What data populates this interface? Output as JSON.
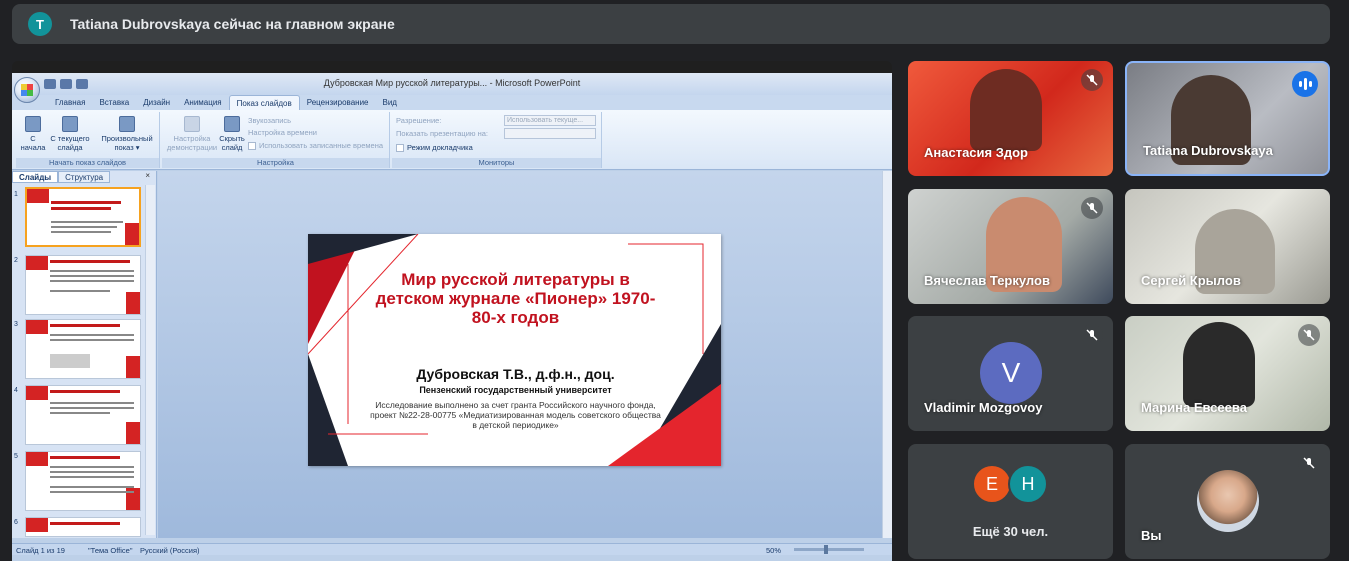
{
  "banner": {
    "avatar_letter": "T",
    "text": "Tatiana Dubrovskaya сейчас на главном экране"
  },
  "ppt": {
    "window_title": "Дубровская Мир русской литературы... - Microsoft PowerPoint",
    "tabs": [
      "Главная",
      "Вставка",
      "Дизайн",
      "Анимация",
      "Показ слайдов",
      "Рецензирование",
      "Вид"
    ],
    "active_tab": "Показ слайдов",
    "ribbon": {
      "btn_from_start": "С начала",
      "btn_from_current": "С текущего слайда",
      "btn_custom": "Произвольный показ ▾",
      "group_start": "Начать показ слайдов",
      "btn_setup": "Настройка демонстрации",
      "btn_hide": "Скрыть слайд",
      "chk_record": "Звукозапись",
      "chk_timings": "Настройка времени",
      "chk_use_timings": "Использовать записанные времена",
      "group_setup": "Настройка",
      "lbl_resolution": "Разрешение:",
      "val_resolution": "Использовать текуще...",
      "lbl_show_on": "Показать презентацию на:",
      "chk_presenter": "Режим докладчика",
      "group_monitors": "Мониторы"
    },
    "pane_tabs": [
      "Слайды",
      "Структура"
    ],
    "pane_close": "×",
    "thumb_numbers": [
      "1",
      "2",
      "3",
      "4",
      "5",
      "6"
    ],
    "slide": {
      "title": "Мир русской литературы в детском журнале «Пионер» 1970-80-х годов",
      "author": "Дубровская Т.В., д.ф.н., доц.",
      "university": "Пензенский государственный университет",
      "note": "Исследование выполнено за счет гранта Российского научного фонда, проект №22-28-00775 «Медиатизированная модель советского общества в детской периодике»"
    },
    "status": {
      "slide_count": "Слайд 1 из 19",
      "theme": "\"Тема Office\"",
      "language": "Русский (Россия)",
      "zoom": "50%"
    }
  },
  "participants": [
    {
      "name": "Анастасия Здор",
      "muted": true
    },
    {
      "name": "Tatiana Dubrovskaya",
      "speaking": true
    },
    {
      "name": "Вячеслав Теркулов",
      "muted": true
    },
    {
      "name": "Сергей Крылов",
      "muted": false
    },
    {
      "name": "Vladimir Mozgovoy",
      "avatar": "V",
      "avatar_color": "#5c6bc0",
      "muted": true
    },
    {
      "name": "Марина Евсеева",
      "muted": true
    },
    {
      "name": "Ещё 30 чел.",
      "avatars": [
        "E",
        "H"
      ],
      "avatar_colors": [
        "#e8541b",
        "#12939a"
      ]
    },
    {
      "name": "Вы",
      "muted": true
    }
  ],
  "colors": {
    "meet_bg": "#202124",
    "tile_bg": "#3c4043",
    "accent": "#1a73e8",
    "slide_red": "#c1121f"
  }
}
